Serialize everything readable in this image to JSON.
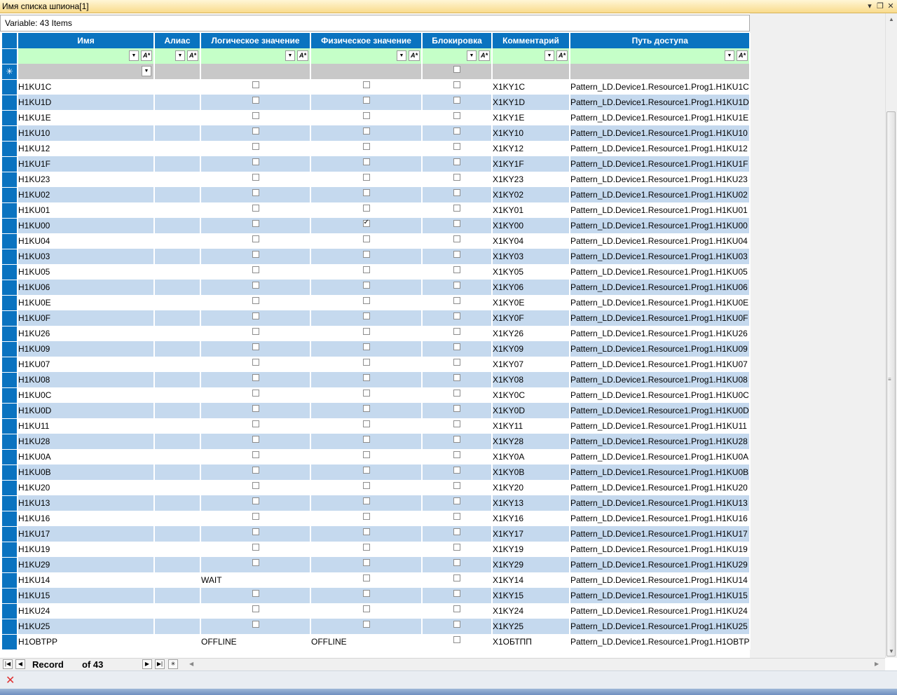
{
  "window": {
    "title": "Имя списка шпиона[1]"
  },
  "summary": "Variable: 43 Items",
  "columns": [
    "Имя",
    "Алиас",
    "Логическое значение",
    "Физическое значение",
    "Блокировка",
    "Комментарий",
    "Путь доступа"
  ],
  "rows": [
    {
      "name": "H1KU1C",
      "alias": "",
      "logical": "false",
      "physical": "false",
      "comment": "X1KY1C",
      "path": "Pattern_LD.Device1.Resource1.Prog1.H1KU1C"
    },
    {
      "name": "H1KU1D",
      "alias": "",
      "logical": "false",
      "physical": "false",
      "comment": "X1KY1D",
      "path": "Pattern_LD.Device1.Resource1.Prog1.H1KU1D"
    },
    {
      "name": "H1KU1E",
      "alias": "",
      "logical": "false",
      "physical": "false",
      "comment": "X1KY1E",
      "path": "Pattern_LD.Device1.Resource1.Prog1.H1KU1E"
    },
    {
      "name": "H1KU10",
      "alias": "",
      "logical": "false",
      "physical": "false",
      "comment": "X1KY10",
      "path": "Pattern_LD.Device1.Resource1.Prog1.H1KU10"
    },
    {
      "name": "H1KU12",
      "alias": "",
      "logical": "false",
      "physical": "false",
      "comment": "X1KY12",
      "path": "Pattern_LD.Device1.Resource1.Prog1.H1KU12"
    },
    {
      "name": "H1KU1F",
      "alias": "",
      "logical": "false",
      "physical": "false",
      "comment": "X1KY1F",
      "path": "Pattern_LD.Device1.Resource1.Prog1.H1KU1F"
    },
    {
      "name": "H1KU23",
      "alias": "",
      "logical": "false",
      "physical": "false",
      "comment": "X1KY23",
      "path": "Pattern_LD.Device1.Resource1.Prog1.H1KU23"
    },
    {
      "name": "H1KU02",
      "alias": "",
      "logical": "false",
      "physical": "false",
      "comment": "X1KY02",
      "path": "Pattern_LD.Device1.Resource1.Prog1.H1KU02"
    },
    {
      "name": "H1KU01",
      "alias": "",
      "logical": "false",
      "physical": "false",
      "comment": "X1KY01",
      "path": "Pattern_LD.Device1.Resource1.Prog1.H1KU01"
    },
    {
      "name": "H1KU00",
      "alias": "",
      "logical": "false",
      "physical": "true",
      "comment": "X1KY00",
      "path": "Pattern_LD.Device1.Resource1.Prog1.H1KU00"
    },
    {
      "name": "H1KU04",
      "alias": "",
      "logical": "false",
      "physical": "false",
      "comment": "X1KY04",
      "path": "Pattern_LD.Device1.Resource1.Prog1.H1KU04"
    },
    {
      "name": "H1KU03",
      "alias": "",
      "logical": "false",
      "physical": "false",
      "comment": "X1KY03",
      "path": "Pattern_LD.Device1.Resource1.Prog1.H1KU03"
    },
    {
      "name": "H1KU05",
      "alias": "",
      "logical": "false",
      "physical": "false",
      "comment": "X1KY05",
      "path": "Pattern_LD.Device1.Resource1.Prog1.H1KU05"
    },
    {
      "name": "H1KU06",
      "alias": "",
      "logical": "false",
      "physical": "false",
      "comment": "X1KY06",
      "path": "Pattern_LD.Device1.Resource1.Prog1.H1KU06"
    },
    {
      "name": "H1KU0E",
      "alias": "",
      "logical": "false",
      "physical": "false",
      "comment": "X1KY0E",
      "path": "Pattern_LD.Device1.Resource1.Prog1.H1KU0E"
    },
    {
      "name": "H1KU0F",
      "alias": "",
      "logical": "false",
      "physical": "false",
      "comment": "X1KY0F",
      "path": "Pattern_LD.Device1.Resource1.Prog1.H1KU0F"
    },
    {
      "name": "H1KU26",
      "alias": "",
      "logical": "false",
      "physical": "false",
      "comment": "X1KY26",
      "path": "Pattern_LD.Device1.Resource1.Prog1.H1KU26"
    },
    {
      "name": "H1KU09",
      "alias": "",
      "logical": "false",
      "physical": "false",
      "comment": "X1KY09",
      "path": "Pattern_LD.Device1.Resource1.Prog1.H1KU09"
    },
    {
      "name": "H1KU07",
      "alias": "",
      "logical": "false",
      "physical": "false",
      "comment": "X1KY07",
      "path": "Pattern_LD.Device1.Resource1.Prog1.H1KU07"
    },
    {
      "name": "H1KU08",
      "alias": "",
      "logical": "false",
      "physical": "false",
      "comment": "X1KY08",
      "path": "Pattern_LD.Device1.Resource1.Prog1.H1KU08"
    },
    {
      "name": "H1KU0C",
      "alias": "",
      "logical": "false",
      "physical": "false",
      "comment": "X1KY0C",
      "path": "Pattern_LD.Device1.Resource1.Prog1.H1KU0C"
    },
    {
      "name": "H1KU0D",
      "alias": "",
      "logical": "false",
      "physical": "false",
      "comment": "X1KY0D",
      "path": "Pattern_LD.Device1.Resource1.Prog1.H1KU0D"
    },
    {
      "name": "H1KU11",
      "alias": "",
      "logical": "false",
      "physical": "false",
      "comment": "X1KY11",
      "path": "Pattern_LD.Device1.Resource1.Prog1.H1KU11"
    },
    {
      "name": "H1KU28",
      "alias": "",
      "logical": "false",
      "physical": "false",
      "comment": "X1KY28",
      "path": "Pattern_LD.Device1.Resource1.Prog1.H1KU28"
    },
    {
      "name": "H1KU0A",
      "alias": "",
      "logical": "false",
      "physical": "false",
      "comment": "X1KY0A",
      "path": "Pattern_LD.Device1.Resource1.Prog1.H1KU0A"
    },
    {
      "name": "H1KU0B",
      "alias": "",
      "logical": "false",
      "physical": "false",
      "comment": "X1KY0B",
      "path": "Pattern_LD.Device1.Resource1.Prog1.H1KU0B"
    },
    {
      "name": "H1KU20",
      "alias": "",
      "logical": "false",
      "physical": "false",
      "comment": "X1KY20",
      "path": "Pattern_LD.Device1.Resource1.Prog1.H1KU20"
    },
    {
      "name": "H1KU13",
      "alias": "",
      "logical": "false",
      "physical": "false",
      "comment": "X1KY13",
      "path": "Pattern_LD.Device1.Resource1.Prog1.H1KU13"
    },
    {
      "name": "H1KU16",
      "alias": "",
      "logical": "false",
      "physical": "false",
      "comment": "X1KY16",
      "path": "Pattern_LD.Device1.Resource1.Prog1.H1KU16"
    },
    {
      "name": "H1KU17",
      "alias": "",
      "logical": "false",
      "physical": "false",
      "comment": "X1KY17",
      "path": "Pattern_LD.Device1.Resource1.Prog1.H1KU17"
    },
    {
      "name": "H1KU19",
      "alias": "",
      "logical": "false",
      "physical": "false",
      "comment": "X1KY19",
      "path": "Pattern_LD.Device1.Resource1.Prog1.H1KU19"
    },
    {
      "name": "H1KU29",
      "alias": "",
      "logical": "false",
      "physical": "false",
      "comment": "X1KY29",
      "path": "Pattern_LD.Device1.Resource1.Prog1.H1KU29"
    },
    {
      "name": "H1KU14",
      "alias": "",
      "logical": "WAIT",
      "physical": "false",
      "comment": "X1KY14",
      "path": "Pattern_LD.Device1.Resource1.Prog1.H1KU14"
    },
    {
      "name": "H1KU15",
      "alias": "",
      "logical": "false",
      "physical": "false",
      "comment": "X1KY15",
      "path": "Pattern_LD.Device1.Resource1.Prog1.H1KU15"
    },
    {
      "name": "H1KU24",
      "alias": "",
      "logical": "false",
      "physical": "false",
      "comment": "X1KY24",
      "path": "Pattern_LD.Device1.Resource1.Prog1.H1KU24"
    },
    {
      "name": "H1KU25",
      "alias": "",
      "logical": "false",
      "physical": "false",
      "comment": "X1KY25",
      "path": "Pattern_LD.Device1.Resource1.Prog1.H1KU25"
    },
    {
      "name": "H1OBTPP",
      "alias": "",
      "logical": "OFFLINE",
      "physical": "OFFLINE",
      "comment": "X1OБТПП",
      "path": "Pattern_LD.Device1.Resource1.Prog1.H1OBTP"
    }
  ],
  "navigator": {
    "record_label": "Record",
    "of_label": "of 43"
  },
  "colors": {
    "header": "#0a73c0",
    "filter": "#c5ffc8",
    "alt_row": "#c5d9ee",
    "new_row": "#c8c8c8"
  },
  "icons": {
    "delete": "close-icon",
    "filter": "funnel-icon"
  }
}
